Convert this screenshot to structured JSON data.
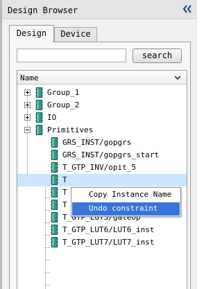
{
  "window": {
    "title": "Design Browser",
    "collapse_icon": "double-chevron-left-icon"
  },
  "tabs": [
    {
      "label": "Design",
      "active": true
    },
    {
      "label": "Device",
      "active": false
    }
  ],
  "search": {
    "value": "",
    "placeholder": "",
    "button_label": "search"
  },
  "tree": {
    "header": "Name",
    "nodes": [
      {
        "label": "Group_1",
        "expanded": false
      },
      {
        "label": "Group_2",
        "expanded": false
      },
      {
        "label": "IO",
        "expanded": false
      },
      {
        "label": "Primitives",
        "expanded": true
      },
      {
        "label": "GRS_INST/gopgrs"
      },
      {
        "label": "GRS_INST/gopgrs_start"
      },
      {
        "label": "T_GTP_INV/opit_5"
      },
      {
        "label": "T",
        "selected": true
      },
      {
        "label": "T"
      },
      {
        "label": "T"
      },
      {
        "label": "T_GTP_LUT5/gateop"
      },
      {
        "label": "T_GTP_LUT6/LUT6_inst"
      },
      {
        "label": "T_GTP_LUT7/LUT7_inst"
      }
    ]
  },
  "context_menu": {
    "items": [
      {
        "label": "Copy Instance Name",
        "highlighted": false
      },
      {
        "label": "Undo constraint",
        "highlighted": true
      }
    ]
  },
  "colors": {
    "selection": "#cce6ff",
    "menu_highlight": "#3875d7",
    "node_icon": "#2f9a86"
  }
}
